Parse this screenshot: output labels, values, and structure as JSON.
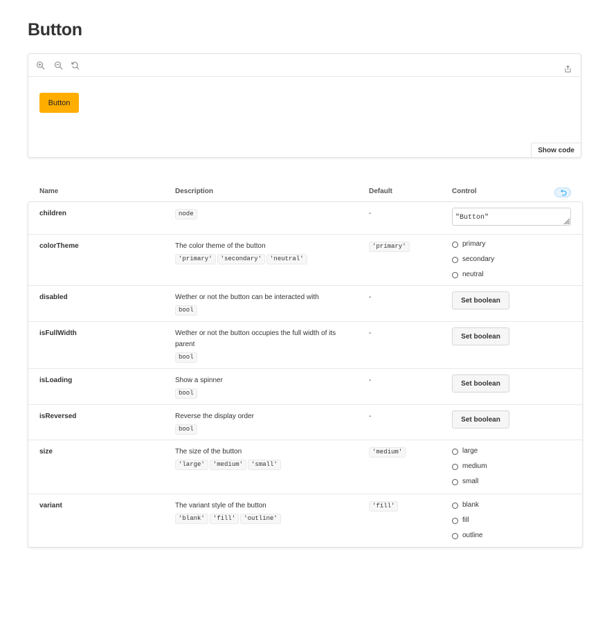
{
  "page": {
    "title": "Button"
  },
  "preview": {
    "demo_button_label": "Button",
    "show_code_label": "Show code",
    "accent_color": "#ffae00"
  },
  "table": {
    "headers": {
      "name": "Name",
      "description": "Description",
      "default": "Default",
      "control": "Control"
    },
    "rows": [
      {
        "name": "children",
        "description": "",
        "types": [
          "node"
        ],
        "default": "-",
        "control_type": "text",
        "control_value": "\"Button\""
      },
      {
        "name": "colorTheme",
        "description": "The color theme of the button",
        "types": [
          "'primary'",
          "'secondary'",
          "'neutral'"
        ],
        "default": "'primary'",
        "control_type": "radio",
        "options": [
          "primary",
          "secondary",
          "neutral"
        ]
      },
      {
        "name": "disabled",
        "description": "Wether or not the button can be interacted with",
        "types": [
          "bool"
        ],
        "default": "-",
        "control_type": "boolean",
        "control_label": "Set boolean"
      },
      {
        "name": "isFullWidth",
        "description": "Wether or not the button occupies the full width of its parent",
        "types": [
          "bool"
        ],
        "default": "-",
        "control_type": "boolean",
        "control_label": "Set boolean"
      },
      {
        "name": "isLoading",
        "description": "Show a spinner",
        "types": [
          "bool"
        ],
        "default": "-",
        "control_type": "boolean",
        "control_label": "Set boolean"
      },
      {
        "name": "isReversed",
        "description": "Reverse the display order",
        "types": [
          "bool"
        ],
        "default": "-",
        "control_type": "boolean",
        "control_label": "Set boolean"
      },
      {
        "name": "size",
        "description": "The size of the button",
        "types": [
          "'large'",
          "'medium'",
          "'small'"
        ],
        "default": "'medium'",
        "control_type": "radio",
        "options": [
          "large",
          "medium",
          "small"
        ]
      },
      {
        "name": "variant",
        "description": "The variant style of the button",
        "types": [
          "'blank'",
          "'fill'",
          "'outline'"
        ],
        "default": "'fill'",
        "control_type": "radio",
        "options": [
          "blank",
          "fill",
          "outline"
        ]
      }
    ]
  },
  "icons": [
    "zoom-in-icon",
    "zoom-out-icon",
    "zoom-reset-icon",
    "share-icon",
    "undo-icon",
    "resize-grip-icon"
  ]
}
